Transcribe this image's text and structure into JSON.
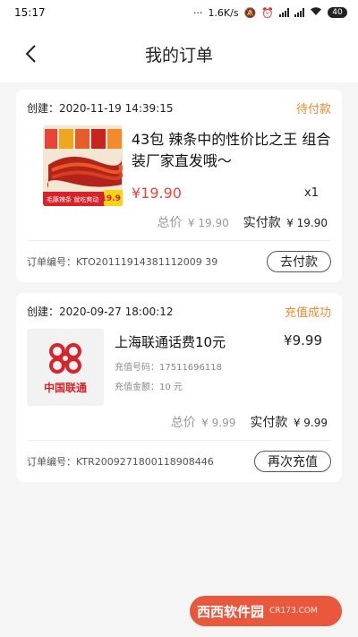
{
  "status_bar": {
    "time": "15:17",
    "speed": "1.6K/s",
    "battery": "40"
  },
  "nav": {
    "title": "我的订单"
  },
  "orders": [
    {
      "created_label": "创建：",
      "created": "2020-11-19 14:39:15",
      "status": "待付款",
      "title": "43包 辣条中的性价比之王 组合装厂家直发哦～",
      "price": "¥19.90",
      "qty": "x1",
      "total_label": "总价",
      "total": "¥ 19.90",
      "paid_label": "实付款",
      "paid": "¥ 19.90",
      "order_no_label": "订单编号：",
      "order_no": "KTO20111914381112009 39",
      "action": "去付款",
      "thumb_badge": "19.9",
      "thumb_tag": "毛豚辣条 就吃爽动"
    },
    {
      "created_label": "创建：",
      "created": "2020-09-27 18:00:12",
      "status": "充值成功",
      "title": "上海联通话费10元",
      "price": "¥9.99",
      "phone_label": "充值号码：",
      "phone": "17511696118",
      "amount_label": "充值金额：",
      "amount": "10 元",
      "brand": "中国联通",
      "total_label": "总价",
      "total": "¥ 9.99",
      "paid_label": "实付款",
      "paid": "¥ 9.99",
      "order_no_label": "订单编号：",
      "order_no": "KTR2009271800118908446",
      "action": "再次充值"
    }
  ],
  "watermark": {
    "brand": "西西软件园",
    "url": "CR173.COM"
  },
  "colors": {
    "accent_orange": "#f28a2e",
    "price_red": "#e8443a",
    "unicom_red": "#d9232a"
  }
}
